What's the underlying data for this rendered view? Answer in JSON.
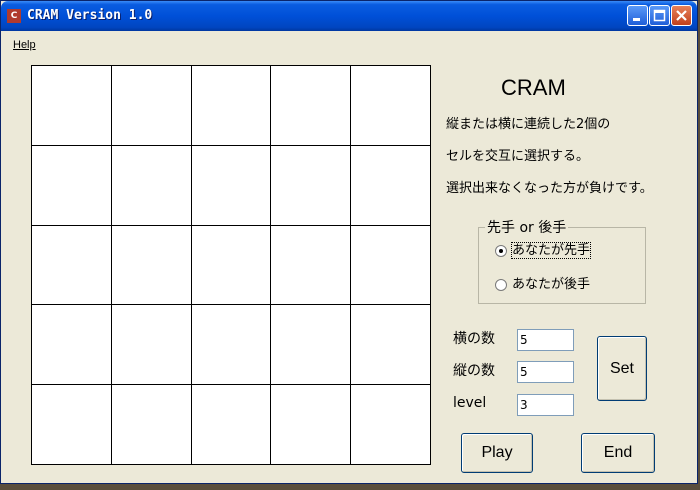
{
  "window": {
    "title": "CRAM Version 1.0",
    "icon": "app-icon"
  },
  "menu": {
    "items": [
      {
        "label": "Help",
        "accelerator": "H"
      }
    ]
  },
  "board": {
    "columns": 5,
    "rows": 5
  },
  "info": {
    "app_title": "CRAM",
    "rules": [
      "縦または横に連続した2個の",
      "セルを交互に選択する。",
      "選択出来なくなった方が負けです。"
    ]
  },
  "turn_group": {
    "legend": "先手 or 後手",
    "options": [
      {
        "label": "あなたが先手",
        "checked": true
      },
      {
        "label": "あなたが後手",
        "checked": false
      }
    ]
  },
  "settings": {
    "width_label": "横の数",
    "width_value": "5",
    "height_label": "縦の数",
    "height_value": "5",
    "level_label": "level",
    "level_value": "3"
  },
  "buttons": {
    "set": "Set",
    "play": "Play",
    "end": "End"
  }
}
